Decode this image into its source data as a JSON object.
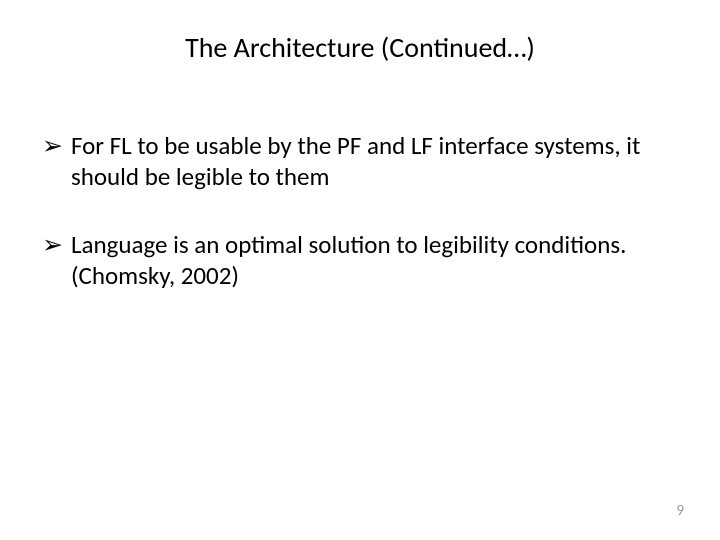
{
  "slide": {
    "title": "The Architecture (Continued…)",
    "bullets": [
      {
        "text": "For FL to be usable by the PF and LF interface systems, it should be legible to them"
      },
      {
        "text": "Language is an optimal solution to legibility conditions. (Chomsky, 2002)"
      }
    ],
    "bullet_marker": "➢",
    "page_number": "9"
  }
}
